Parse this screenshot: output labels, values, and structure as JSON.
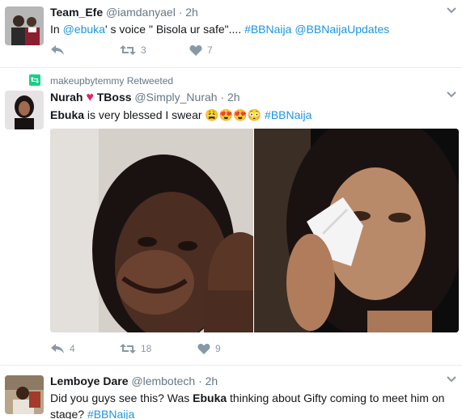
{
  "tweets": [
    {
      "name": "Team_Efe",
      "handle": "@iamdanyael",
      "time": "2h",
      "text_prefix": "In ",
      "mention": "@ebuka",
      "text_mid": "' s voice \" Bisola ur safe\"....",
      "hashtag1": "#BBNaija",
      "mention2": "@BBNaijaUpdates",
      "retweets": "3",
      "likes": "7"
    },
    {
      "retweeted_by": "makeupbytemmy Retweeted",
      "name_part1": "Nurah",
      "name_part2": "TBoss",
      "handle": "@Simply_Nurah",
      "time": "2h",
      "text_bold": "Ebuka",
      "text_rest": " is very blessed I swear ",
      "emojis": "😩😍😍😳",
      "hashtag": "#BBNaija",
      "replies": "4",
      "retweets": "18",
      "likes": "9"
    },
    {
      "name": "Lemboye Dare",
      "handle": "@lembotech",
      "time": "2h",
      "text_1": "Did you guys see this? Was ",
      "text_bold": "Ebuka",
      "text_2": " thinking about Gifty coming to meet him on",
      "text_3": "stage? ",
      "hashtag": "#BBNaija"
    }
  ],
  "colors": {
    "link": "#1b95e0",
    "heart": "#e0245e",
    "retweet_green": "#19cf86",
    "muted": "#657786"
  },
  "icons": [
    "reply-icon",
    "retweet-icon",
    "like-icon",
    "chevron-down-icon",
    "retweet-badge-icon",
    "heart-emoji"
  ]
}
